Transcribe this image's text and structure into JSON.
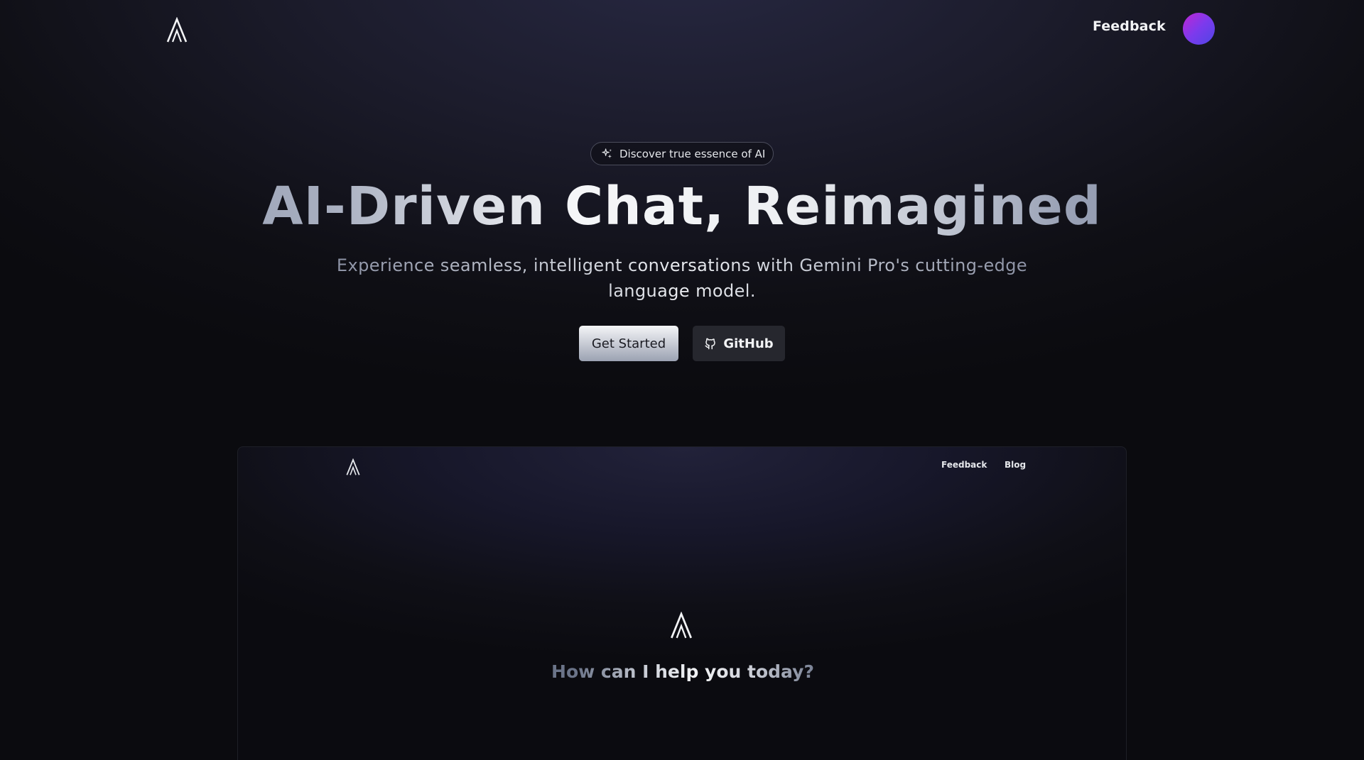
{
  "header": {
    "logo_icon": "aeon-logo-icon",
    "feedback_label": "Feedback",
    "avatar_gradient": [
      "#c026d3",
      "#7c3aed",
      "#4f46e5"
    ]
  },
  "hero": {
    "badge_icon": "sparkles-icon",
    "badge_text": "Discover true essence of AI",
    "title": "AI-Driven Chat, Reimagined",
    "subtitle": "Experience seamless, intelligent conversations with Gemini Pro's cutting-edge language model.",
    "primary_button_label": "Get Started",
    "secondary_button_label": "GitHub",
    "secondary_button_icon": "github-icon"
  },
  "preview": {
    "nav": {
      "feedback_label": "Feedback",
      "blog_label": "Blog"
    },
    "greeting": "How can I help you today?"
  },
  "colors": {
    "background": "#0b0b0f",
    "text": "#f3f4f6",
    "button_dark": "#26272e"
  }
}
